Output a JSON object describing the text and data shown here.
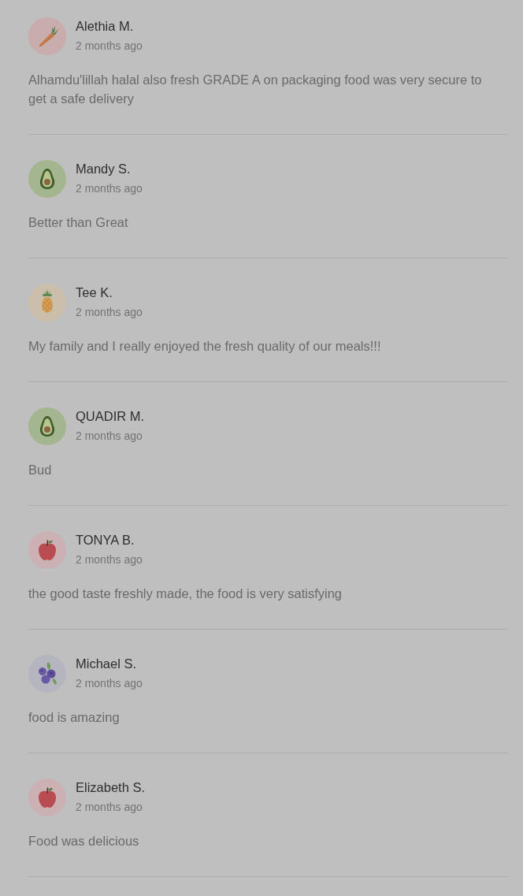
{
  "reviews": [
    {
      "kind": "carrot",
      "name": "Alethia M.",
      "date": "2 months ago",
      "text": "Alhamdu'lillah halal also fresh GRADE A on packaging food was very secure to get a safe delivery"
    },
    {
      "kind": "avocado",
      "name": "Mandy S.",
      "date": "2 months ago",
      "text": "Better than Great"
    },
    {
      "kind": "pineapple",
      "name": "Tee K.",
      "date": "2 months ago",
      "text": "My family and I really enjoyed the fresh quality of our meals!!!"
    },
    {
      "kind": "avocado",
      "name": "QUADIR M.",
      "date": "2 months ago",
      "text": "Bud"
    },
    {
      "kind": "apple",
      "name": "TONYA B.",
      "date": "2 months ago",
      "text": "the good taste freshly made, the food is very satisfying"
    },
    {
      "kind": "blueberries",
      "name": "Michael S.",
      "date": "2 months ago",
      "text": "food is amazing"
    },
    {
      "kind": "apple",
      "name": "Elizabeth S.",
      "date": "2 months ago",
      "text": "Food was delicious"
    }
  ]
}
